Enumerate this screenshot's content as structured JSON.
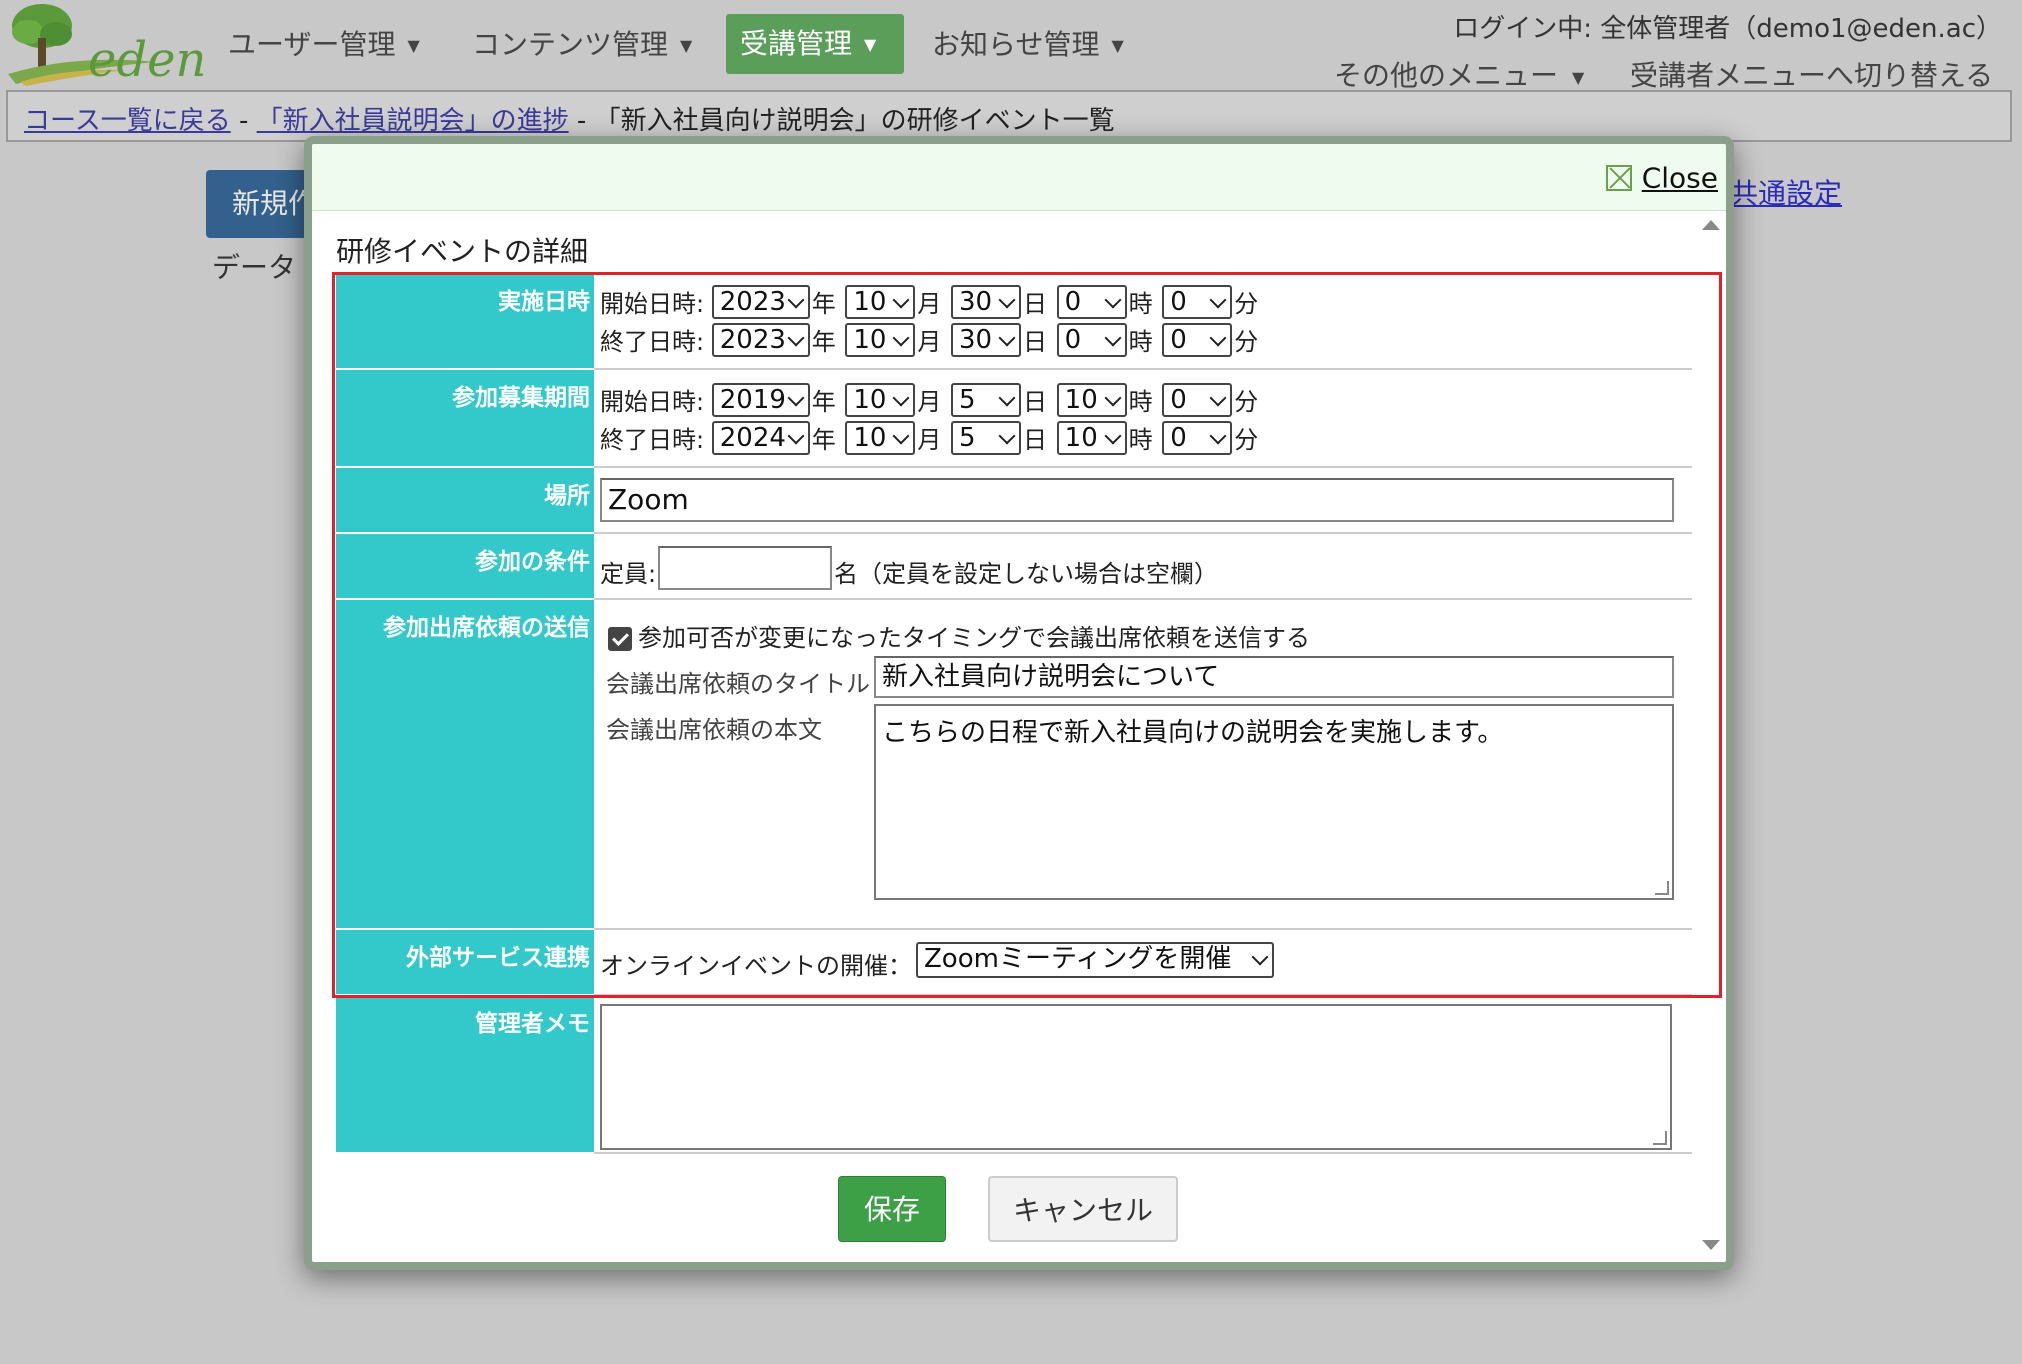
{
  "header": {
    "logo_text": "eden",
    "nav": [
      {
        "label": "ユーザー管理"
      },
      {
        "label": "コンテンツ管理"
      },
      {
        "label": "受講管理"
      },
      {
        "label": "お知らせ管理"
      }
    ],
    "login_info": "ログイン中: 全体管理者（demo1@eden.ac）",
    "other_menu": "その他のメニュー",
    "switch_menu": "受講者メニューへ切り替える"
  },
  "breadcrumb": {
    "link1": "コース一覧に戻る",
    "sep": " - ",
    "link2": "「新入社員説明会」の進捗",
    "current": "「新入社員向け説明会」の研修イベント一覧"
  },
  "background": {
    "new_button": "新規作成",
    "data_label": "データ",
    "common_link": "共通設定"
  },
  "modal": {
    "close_label": "Close",
    "title": "研修イベントの詳細",
    "labels": {
      "schedule": "実施日時",
      "recruit": "参加募集期間",
      "place": "場所",
      "condition": "参加の条件",
      "invite": "参加出席依頼の送信",
      "external": "外部サービス連携",
      "memo": "管理者メモ"
    },
    "units": {
      "year": "年",
      "month": "月",
      "day": "日",
      "hour": "時",
      "minute": "分"
    },
    "start_label": "開始日時:",
    "end_label": "終了日時:",
    "schedule_start": {
      "year": "2023",
      "month": "10",
      "day": "30",
      "hour": "0",
      "minute": "0"
    },
    "schedule_end": {
      "year": "2023",
      "month": "10",
      "day": "30",
      "hour": "0",
      "minute": "0"
    },
    "recruit_start": {
      "year": "2019",
      "month": "10",
      "day": "5",
      "hour": "10",
      "minute": "0"
    },
    "recruit_end": {
      "year": "2024",
      "month": "10",
      "day": "5",
      "hour": "10",
      "minute": "0"
    },
    "place_value": "Zoom",
    "capacity_label": "定員:",
    "capacity_value": "",
    "capacity_note": "名（定員を設定しない場合は空欄）",
    "invite_checkbox_label": "参加可否が変更になったタイミングで会議出席依頼を送信する",
    "invite_title_label": "会議出席依頼のタイトル",
    "invite_title_value": "新入社員向け説明会について",
    "invite_body_label": "会議出席依頼の本文",
    "invite_body_value": "こちらの日程で新入社員向けの説明会を実施します。",
    "online_label": "オンラインイベントの開催：",
    "online_value": "Zoomミーティングを開催",
    "memo_value": "",
    "save_label": "保存",
    "cancel_label": "キャンセル"
  },
  "colors": {
    "label_bg": "#33c9cb",
    "active_nav": "#5b9e5a",
    "highlight_frame": "#e0222a",
    "save_button": "#3ea046"
  }
}
